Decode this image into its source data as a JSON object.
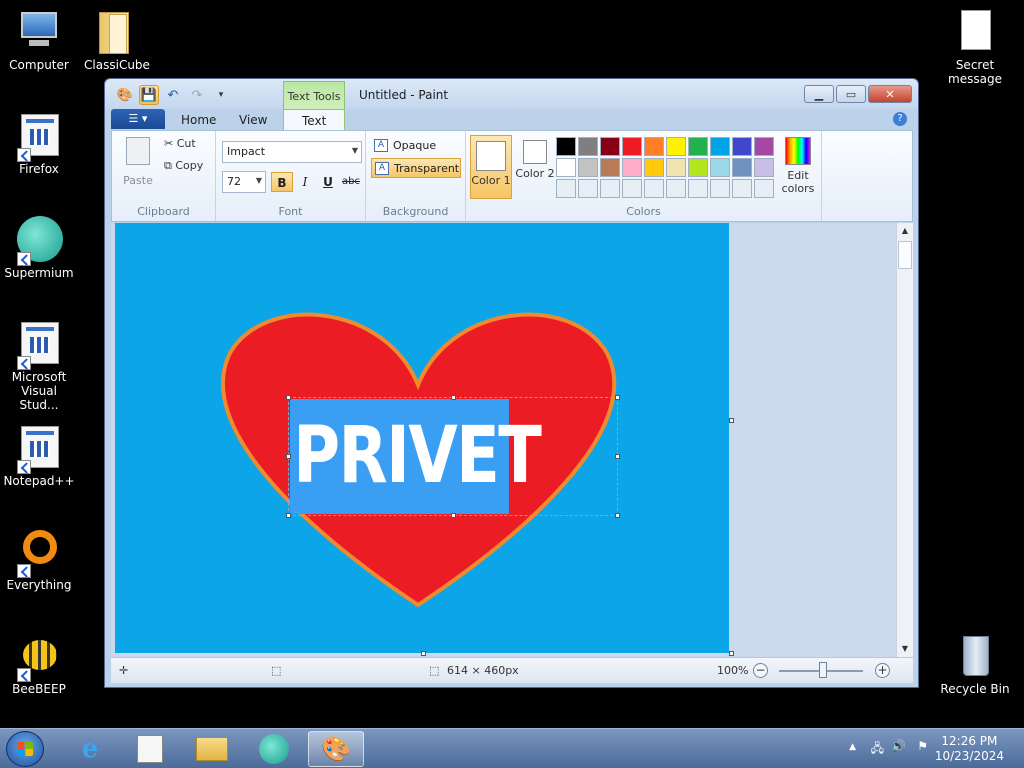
{
  "desktop": {
    "icons_left": [
      {
        "label": "Computer"
      },
      {
        "label": "ClassiCube"
      },
      {
        "label": "Firefox"
      },
      {
        "label": "Supermium"
      },
      {
        "label": "Microsoft Visual Stud..."
      },
      {
        "label": "Notepad++"
      },
      {
        "label": "Everything"
      },
      {
        "label": "BeeBEEP"
      }
    ],
    "secret_message": "Secret message",
    "recycle_bin": "Recycle Bin"
  },
  "window": {
    "title": "Untitled - Paint",
    "contextual_tab": "Text Tools",
    "tabs": [
      "Home",
      "View",
      "Text"
    ],
    "active_tab": "Text"
  },
  "ribbon": {
    "clipboard": {
      "paste": "Paste",
      "cut": "Cut",
      "copy": "Copy",
      "label": "Clipboard"
    },
    "font": {
      "family": "Impact",
      "size": "72",
      "bold": "B",
      "italic": "I",
      "underline": "U",
      "strike": "abc",
      "label": "Font"
    },
    "background": {
      "opaque": "Opaque",
      "transparent": "Transparent",
      "label": "Background"
    },
    "colors": {
      "color1": "Color 1",
      "color2": "Color 2",
      "edit": "Edit colors",
      "label": "Colors",
      "palette": [
        "#000000",
        "#7f7f7f",
        "#880015",
        "#ed1c24",
        "#ff7f27",
        "#fff200",
        "#22b14c",
        "#00a2e8",
        "#3f48cc",
        "#a349a4",
        "#ffffff",
        "#c3c3c3",
        "#b97a57",
        "#ffaec9",
        "#ffc90e",
        "#efe4b0",
        "#b5e61d",
        "#99d9ea",
        "#7092be",
        "#c8bfe7"
      ]
    }
  },
  "canvas": {
    "text": "PRIVET",
    "background_color": "#0ba5e8",
    "heart_color": "#ec1c24",
    "heart_outline": "#f08a2e"
  },
  "status": {
    "size": "614 × 460px",
    "zoom": "100%"
  },
  "taskbar": {
    "time": "12:26 PM",
    "date": "10/23/2024"
  }
}
